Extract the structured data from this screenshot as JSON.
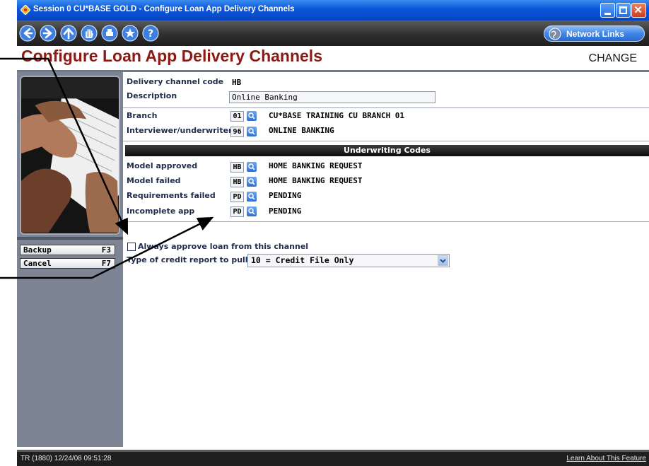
{
  "window": {
    "title": "Session 0 CU*BASE GOLD - Configure Loan App Delivery Channels"
  },
  "toolbar": {
    "buttons": [
      "back-icon",
      "forward-icon",
      "up-icon",
      "hand-icon",
      "print-icon",
      "star-icon",
      "help-icon"
    ],
    "network_links_label": "Network Links"
  },
  "header": {
    "title": "Configure Loan App Delivery Channels",
    "mode": "CHANGE"
  },
  "left_panel": {
    "function_keys": [
      {
        "label": "Backup",
        "key": "F3"
      },
      {
        "label": "Cancel",
        "key": "F7"
      }
    ]
  },
  "form": {
    "delivery_channel_code": {
      "label": "Delivery channel code",
      "value": "HB"
    },
    "description": {
      "label": "Description",
      "value": "Online Banking"
    },
    "branch": {
      "label": "Branch",
      "code": "01",
      "name": "CU*BASE TRAINING CU BRANCH 01"
    },
    "interviewer": {
      "label": "Interviewer/underwriter",
      "code": "96",
      "name": "ONLINE BANKING"
    },
    "underwriting_header": "Underwriting Codes",
    "underwriting": [
      {
        "label": "Model approved",
        "code": "HB",
        "name": "HOME BANKING REQUEST"
      },
      {
        "label": "Model failed",
        "code": "HB",
        "name": "HOME BANKING REQUEST"
      },
      {
        "label": "Requirements failed",
        "code": "PD",
        "name": "PENDING"
      },
      {
        "label": "Incomplete app",
        "code": "PD",
        "name": "PENDING"
      }
    ],
    "always_approve": {
      "label": "Always approve loan from this channel",
      "checked": false
    },
    "credit_report": {
      "label": "Type of credit report to pull",
      "selected": "10 = Credit File Only"
    }
  },
  "status": {
    "session_info": "TR (1880) 12/24/08 09:51:28",
    "learn_link": "Learn About This Feature"
  },
  "colors": {
    "title": "#8b1a14",
    "titlebar": "#0a55d8",
    "panel": "#7d8595"
  }
}
